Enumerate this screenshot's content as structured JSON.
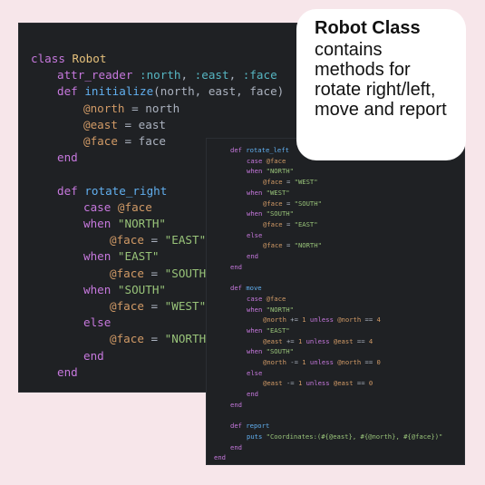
{
  "panel_main": {
    "lines": [
      {
        "indent": 0,
        "parts": [
          [
            "kw",
            "class "
          ],
          [
            "cls",
            "Robot"
          ]
        ]
      },
      {
        "indent": 1,
        "parts": [
          [
            "kw",
            "attr_reader "
          ],
          [
            "sym",
            ":north"
          ],
          [
            "plain",
            ", "
          ],
          [
            "sym",
            ":east"
          ],
          [
            "plain",
            ", "
          ],
          [
            "sym",
            ":face"
          ]
        ]
      },
      {
        "indent": 1,
        "parts": [
          [
            "kw",
            "def "
          ],
          [
            "fn",
            "initialize"
          ],
          [
            "plain",
            "(north, east, face)"
          ]
        ]
      },
      {
        "indent": 2,
        "parts": [
          [
            "ivar",
            "@north"
          ],
          [
            "plain",
            " = north"
          ]
        ]
      },
      {
        "indent": 2,
        "parts": [
          [
            "ivar",
            "@east"
          ],
          [
            "plain",
            " = east"
          ]
        ]
      },
      {
        "indent": 2,
        "parts": [
          [
            "ivar",
            "@face"
          ],
          [
            "plain",
            " = face"
          ]
        ]
      },
      {
        "indent": 1,
        "parts": [
          [
            "kw",
            "end"
          ]
        ]
      },
      {
        "indent": 0,
        "parts": []
      },
      {
        "indent": 1,
        "parts": [
          [
            "kw",
            "def "
          ],
          [
            "fn",
            "rotate_right"
          ]
        ]
      },
      {
        "indent": 2,
        "parts": [
          [
            "kw",
            "case "
          ],
          [
            "ivar",
            "@face"
          ]
        ]
      },
      {
        "indent": 2,
        "parts": [
          [
            "kw",
            "when "
          ],
          [
            "str",
            "\"NORTH\""
          ]
        ]
      },
      {
        "indent": 3,
        "parts": [
          [
            "ivar",
            "@face"
          ],
          [
            "plain",
            " = "
          ],
          [
            "str",
            "\"EAST\""
          ]
        ]
      },
      {
        "indent": 2,
        "parts": [
          [
            "kw",
            "when "
          ],
          [
            "str",
            "\"EAST\""
          ]
        ]
      },
      {
        "indent": 3,
        "parts": [
          [
            "ivar",
            "@face"
          ],
          [
            "plain",
            " = "
          ],
          [
            "str",
            "\"SOUTH'"
          ]
        ]
      },
      {
        "indent": 2,
        "parts": [
          [
            "kw",
            "when "
          ],
          [
            "str",
            "\"SOUTH\""
          ]
        ]
      },
      {
        "indent": 3,
        "parts": [
          [
            "ivar",
            "@face"
          ],
          [
            "plain",
            " = "
          ],
          [
            "str",
            "\"WEST\""
          ]
        ]
      },
      {
        "indent": 2,
        "parts": [
          [
            "kw",
            "else"
          ]
        ]
      },
      {
        "indent": 3,
        "parts": [
          [
            "ivar",
            "@face"
          ],
          [
            "plain",
            " = "
          ],
          [
            "str",
            "\"NORTH'"
          ]
        ]
      },
      {
        "indent": 2,
        "parts": [
          [
            "kw",
            "end"
          ]
        ]
      },
      {
        "indent": 1,
        "parts": [
          [
            "kw",
            "end"
          ]
        ]
      }
    ]
  },
  "panel_secondary": {
    "lines": [
      {
        "indent": 1,
        "parts": [
          [
            "kw",
            "def "
          ],
          [
            "fn",
            "rotate_left"
          ]
        ]
      },
      {
        "indent": 2,
        "parts": [
          [
            "kw",
            "case "
          ],
          [
            "ivar",
            "@face"
          ]
        ]
      },
      {
        "indent": 2,
        "parts": [
          [
            "kw",
            "when "
          ],
          [
            "str",
            "\"NORTH\""
          ]
        ]
      },
      {
        "indent": 3,
        "parts": [
          [
            "ivar",
            "@face"
          ],
          [
            "plain",
            " = "
          ],
          [
            "str",
            "\"WEST\""
          ]
        ]
      },
      {
        "indent": 2,
        "parts": [
          [
            "kw",
            "when "
          ],
          [
            "str",
            "\"WEST\""
          ]
        ]
      },
      {
        "indent": 3,
        "parts": [
          [
            "ivar",
            "@face"
          ],
          [
            "plain",
            " = "
          ],
          [
            "str",
            "\"SOUTH\""
          ]
        ]
      },
      {
        "indent": 2,
        "parts": [
          [
            "kw",
            "when "
          ],
          [
            "str",
            "\"SOUTH\""
          ]
        ]
      },
      {
        "indent": 3,
        "parts": [
          [
            "ivar",
            "@face"
          ],
          [
            "plain",
            " = "
          ],
          [
            "str",
            "\"EAST\""
          ]
        ]
      },
      {
        "indent": 2,
        "parts": [
          [
            "kw",
            "else"
          ]
        ]
      },
      {
        "indent": 3,
        "parts": [
          [
            "ivar",
            "@face"
          ],
          [
            "plain",
            " = "
          ],
          [
            "str",
            "\"NORTH\""
          ]
        ]
      },
      {
        "indent": 2,
        "parts": [
          [
            "kw",
            "end"
          ]
        ]
      },
      {
        "indent": 1,
        "parts": [
          [
            "kw",
            "end"
          ]
        ]
      },
      {
        "indent": 0,
        "parts": []
      },
      {
        "indent": 1,
        "parts": [
          [
            "kw",
            "def "
          ],
          [
            "fn",
            "move"
          ]
        ]
      },
      {
        "indent": 2,
        "parts": [
          [
            "kw",
            "case "
          ],
          [
            "ivar",
            "@face"
          ]
        ]
      },
      {
        "indent": 2,
        "parts": [
          [
            "kw",
            "when "
          ],
          [
            "str",
            "\"NORTH\""
          ]
        ]
      },
      {
        "indent": 3,
        "parts": [
          [
            "ivar",
            "@north"
          ],
          [
            "plain",
            " += "
          ],
          [
            "num",
            "1"
          ],
          [
            "kw",
            " unless "
          ],
          [
            "ivar",
            "@north"
          ],
          [
            "plain",
            " == "
          ],
          [
            "num",
            "4"
          ]
        ]
      },
      {
        "indent": 2,
        "parts": [
          [
            "kw",
            "when "
          ],
          [
            "str",
            "\"EAST\""
          ]
        ]
      },
      {
        "indent": 3,
        "parts": [
          [
            "ivar",
            "@east"
          ],
          [
            "plain",
            " += "
          ],
          [
            "num",
            "1"
          ],
          [
            "kw",
            " unless "
          ],
          [
            "ivar",
            "@east"
          ],
          [
            "plain",
            " == "
          ],
          [
            "num",
            "4"
          ]
        ]
      },
      {
        "indent": 2,
        "parts": [
          [
            "kw",
            "when "
          ],
          [
            "str",
            "\"SOUTH\""
          ]
        ]
      },
      {
        "indent": 3,
        "parts": [
          [
            "ivar",
            "@north"
          ],
          [
            "plain",
            " -= "
          ],
          [
            "num",
            "1"
          ],
          [
            "kw",
            " unless "
          ],
          [
            "ivar",
            "@north"
          ],
          [
            "plain",
            " == "
          ],
          [
            "num",
            "0"
          ]
        ]
      },
      {
        "indent": 2,
        "parts": [
          [
            "kw",
            "else"
          ]
        ]
      },
      {
        "indent": 3,
        "parts": [
          [
            "ivar",
            "@east"
          ],
          [
            "plain",
            " -= "
          ],
          [
            "num",
            "1"
          ],
          [
            "kw",
            " unless "
          ],
          [
            "ivar",
            "@east"
          ],
          [
            "plain",
            " == "
          ],
          [
            "num",
            "0"
          ]
        ]
      },
      {
        "indent": 2,
        "parts": [
          [
            "kw",
            "end"
          ]
        ]
      },
      {
        "indent": 1,
        "parts": [
          [
            "kw",
            "end"
          ]
        ]
      },
      {
        "indent": 0,
        "parts": []
      },
      {
        "indent": 1,
        "parts": [
          [
            "kw",
            "def "
          ],
          [
            "fn",
            "report"
          ]
        ]
      },
      {
        "indent": 2,
        "parts": [
          [
            "fn",
            "puts "
          ],
          [
            "str",
            "\"Coordinates:(#{@east}, #{@north}, #{@face})\""
          ]
        ]
      },
      {
        "indent": 1,
        "parts": [
          [
            "kw",
            "end"
          ]
        ]
      },
      {
        "indent": 0,
        "parts": [
          [
            "kw",
            "end"
          ]
        ]
      }
    ]
  },
  "callout": {
    "title": "Robot Class",
    "body": "contains methods for rotate right/left, move and report"
  }
}
